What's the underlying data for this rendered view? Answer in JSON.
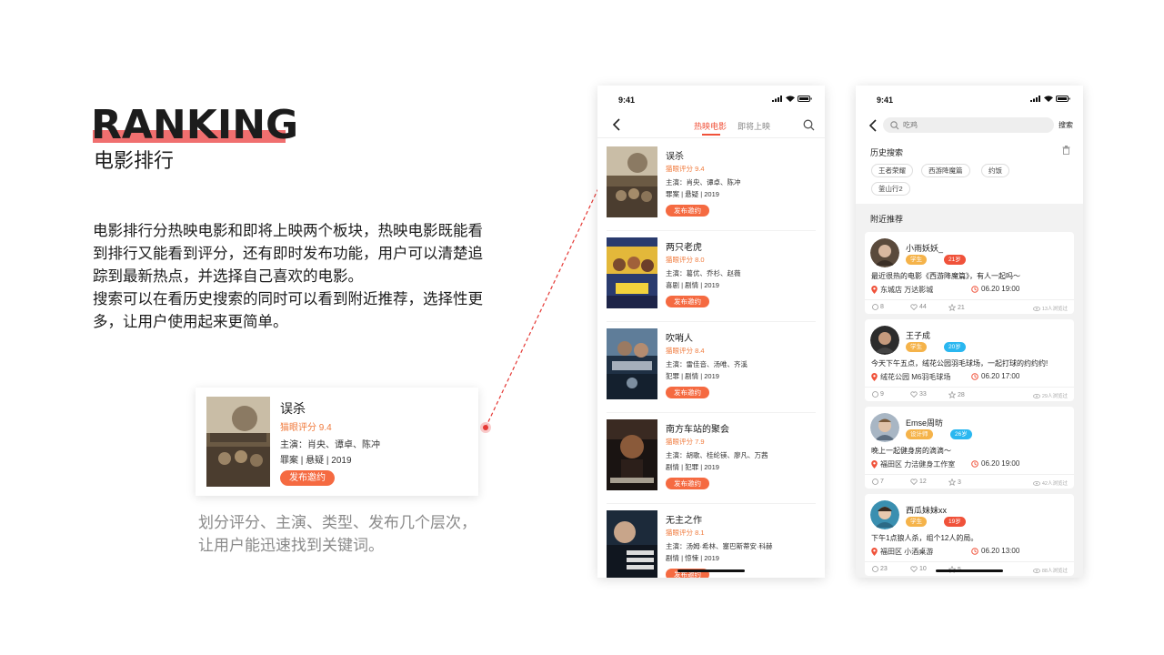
{
  "hero": {
    "title": "RANKING",
    "subtitle": "电影排行",
    "desc_lines": [
      "电影排行分热映电影和即将上映两个板块，热映电影既能看",
      "到排行又能看到评分，还有即时发布功能，用户可以清楚追",
      "踪到最新热点，并选择自己喜欢的电影。",
      "搜索可以在看历史搜索的同时可以看到附近推荐，选择性更",
      "多，让用户使用起来更简单。"
    ]
  },
  "demo": {
    "title": "误杀",
    "score": "猫眼评分 9.4",
    "cast": "主演：肖央、谭卓、陈冲",
    "genre": "罪案 | 悬疑 | 2019",
    "button": "发布邀约",
    "caption_lines": [
      "划分评分、主演、类型、发布几个层次，",
      "让用户能迅速找到关键词。"
    ]
  },
  "phone1": {
    "time": "9:41",
    "tab_active": "热映电影",
    "tab_other": "即将上映",
    "movies": [
      {
        "title": "误杀",
        "score": "猫眼评分 9.4",
        "cast": "主演：肖央、谭卓、陈冲",
        "genre": "罪案 | 悬疑 | 2019",
        "button": "发布邀约"
      },
      {
        "title": "两只老虎",
        "score": "猫眼评分 8.0",
        "cast": "主演：葛优、乔杉、赵薇",
        "genre": "喜剧 | 剧情 | 2019",
        "button": "发布邀约"
      },
      {
        "title": "吹哨人",
        "score": "猫眼评分 8.4",
        "cast": "主演：雷佳音、汤唯、齐溪",
        "genre": "犯罪 | 剧情 | 2019",
        "button": "发布邀约"
      },
      {
        "title": "南方车站的聚会",
        "score": "猫眼评分 7.9",
        "cast": "主演：胡歌、桂纶镁、廖凡、万茜",
        "genre": "剧情 | 犯罪 | 2019",
        "button": "发布邀约"
      },
      {
        "title": "无主之作",
        "score": "猫眼评分 8.1",
        "cast": "主演：汤姆·希林、塞巴斯蒂安·科赫",
        "genre": "剧情 | 惊悚 | 2019",
        "button": "发布邀约"
      }
    ]
  },
  "phone2": {
    "time": "9:41",
    "search_placeholder": "吃鸡",
    "search_button": "搜索",
    "history_title": "历史搜索",
    "history_tags": [
      "王者荣耀",
      "西游降魔篇",
      "约饭",
      "釜山行2"
    ],
    "nearby_title": "附近推荐",
    "users": [
      {
        "name": "小雨妖妖_",
        "occupation": "学生",
        "age": "21岁",
        "age_color": "#f0523a",
        "text": "最近很热的电影《西游降魔篇》，有人一起吗～",
        "location": "东城店 万达影城",
        "time": "06.20 19:00",
        "comments": "8",
        "likes": "44",
        "stars": "21",
        "views": "13人浏览过"
      },
      {
        "name": "王子成",
        "occupation": "学生",
        "age": "20岁",
        "age_color": "#2ab7f0",
        "text": "今天下午五点，绒花公园羽毛球场，一起打球的约约约!",
        "location": "绒花公园 M6羽毛球场",
        "time": "06.20 17:00",
        "comments": "9",
        "likes": "33",
        "stars": "28",
        "views": "29人浏览过"
      },
      {
        "name": "Emse周昉",
        "occupation": "设计师",
        "age": "26岁",
        "age_color": "#2ab7f0",
        "text": "晚上一起健身房的滴滴～",
        "location": "福田区 力洁健身工作室",
        "time": "06.20 19:00",
        "comments": "7",
        "likes": "12",
        "stars": "3",
        "views": "42人浏览过"
      },
      {
        "name": "西瓜妹妹xx",
        "occupation": "学生",
        "age": "19岁",
        "age_color": "#f0523a",
        "text": "下午1点狼人杀，组个12人的局。",
        "location": "福田区 小酒桌游",
        "time": "06.20 13:00",
        "comments": "23",
        "likes": "10",
        "stars": "5",
        "views": "88人浏览过"
      }
    ]
  },
  "colors": {
    "accent": "#f0523a",
    "button": "#f56a41",
    "score": "#f07a3c",
    "hero_underline": "#f06f6f"
  }
}
